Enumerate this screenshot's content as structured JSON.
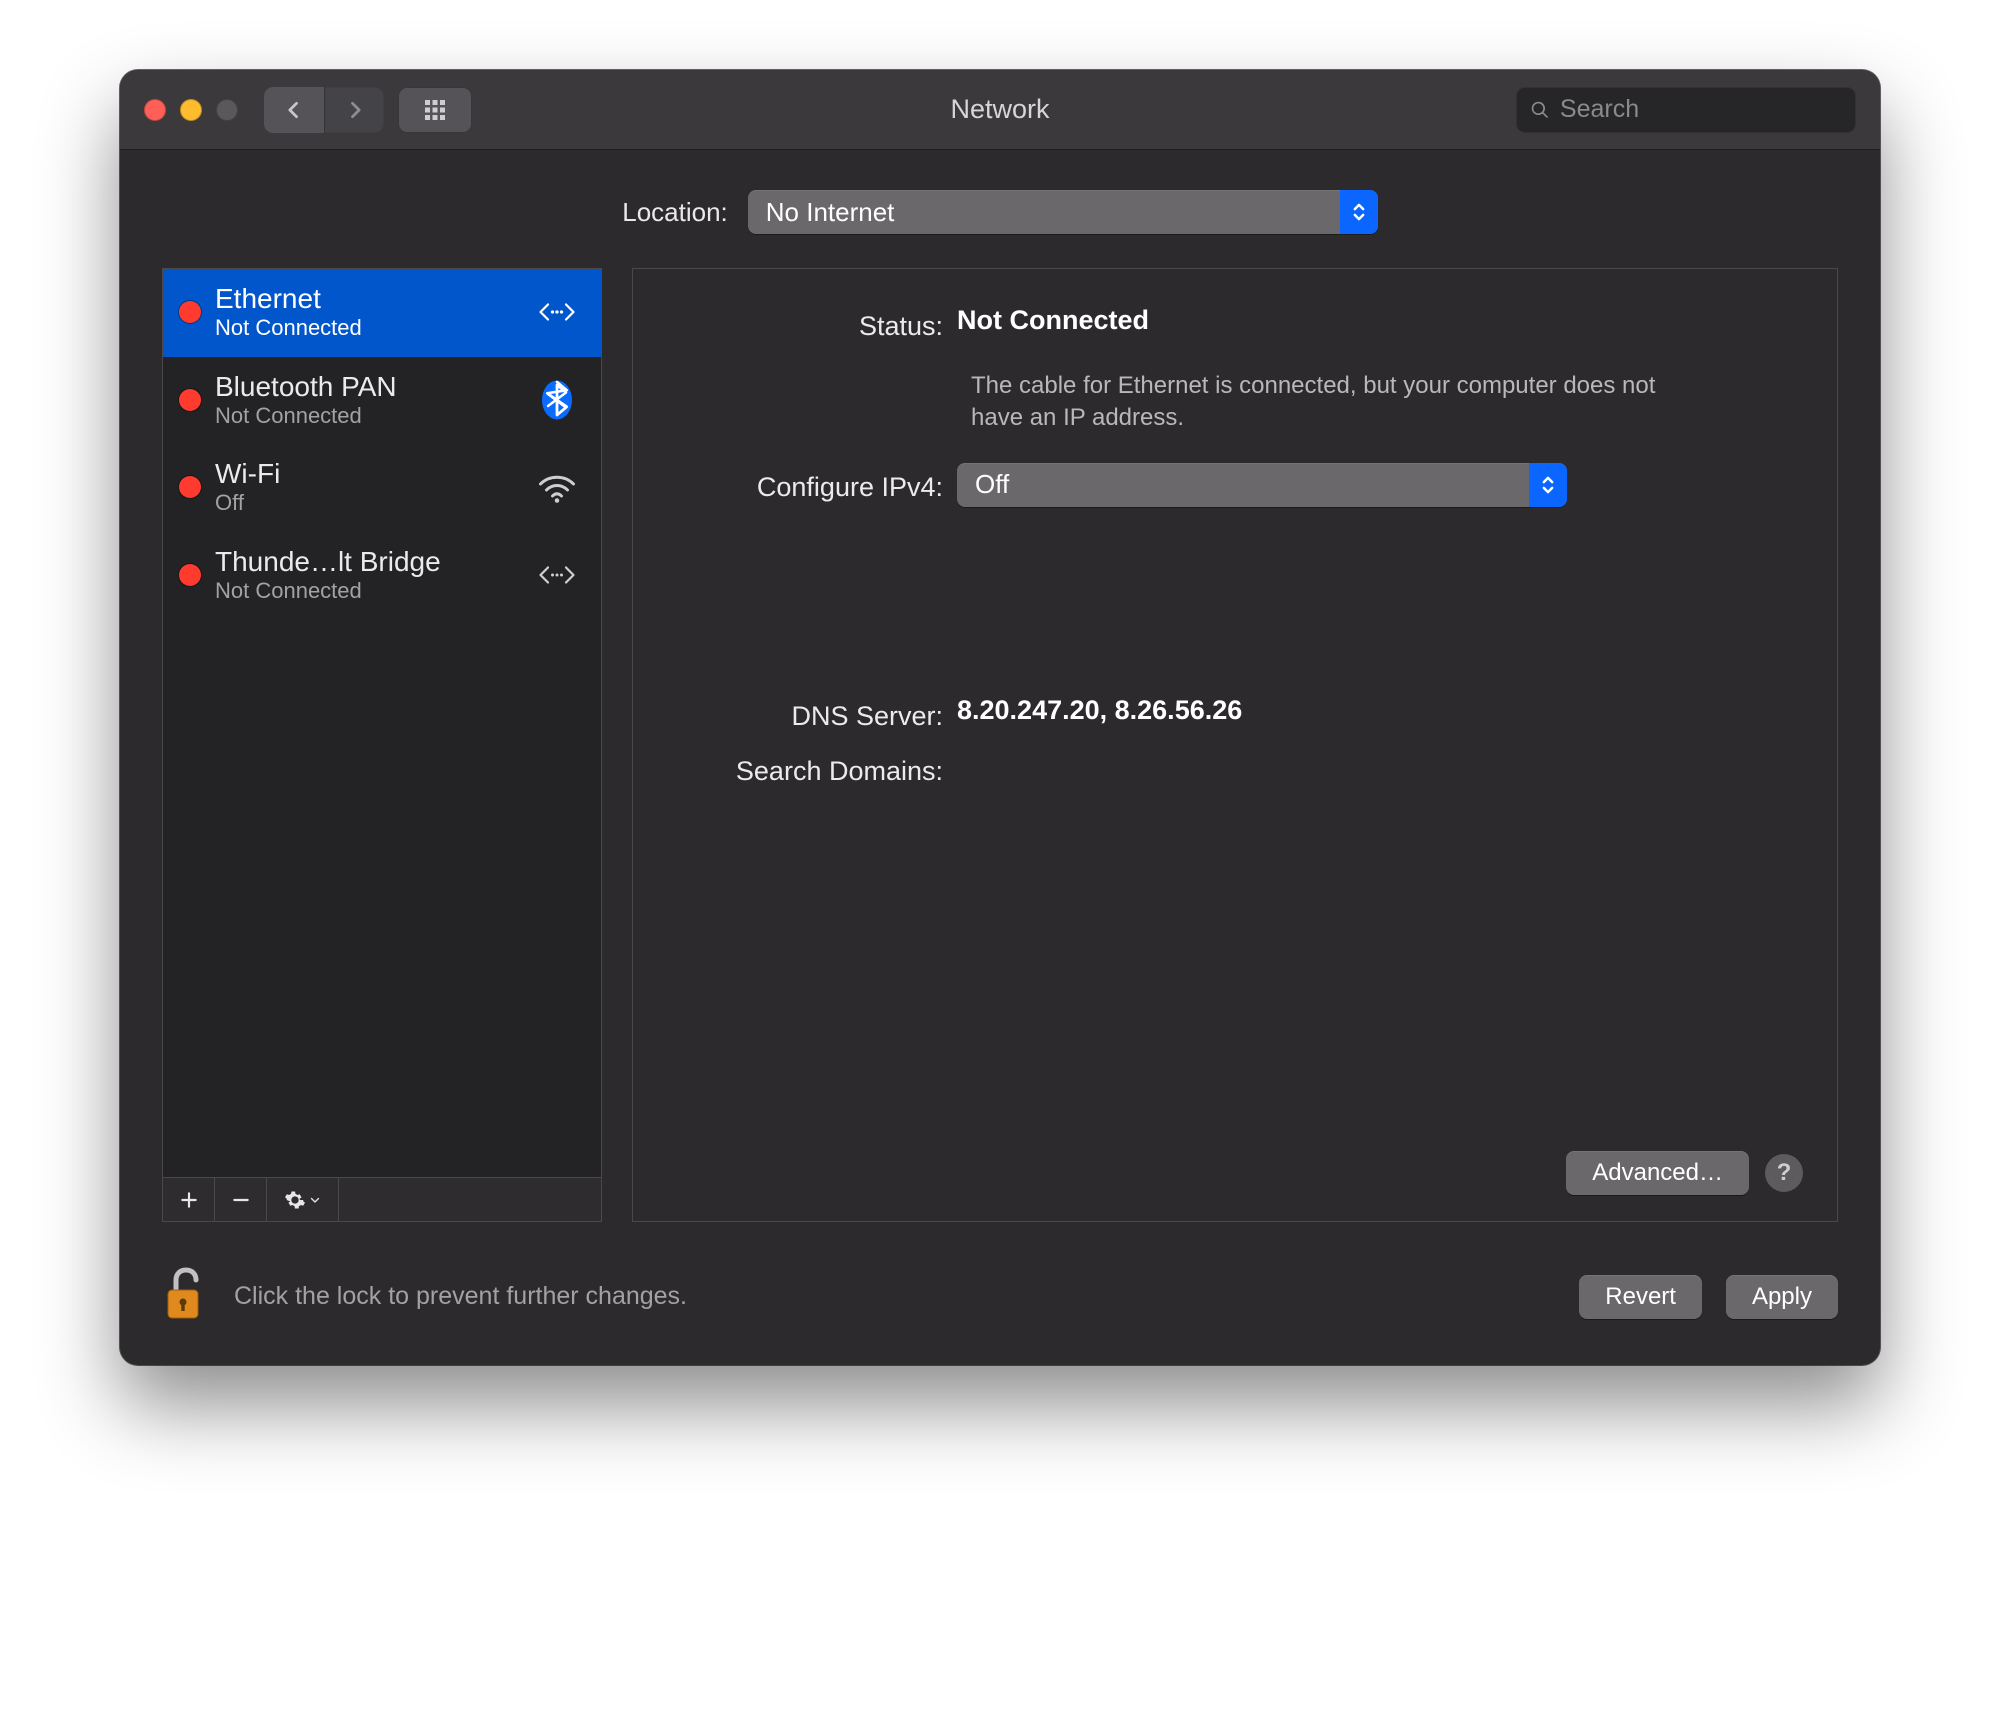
{
  "window": {
    "title": "Network"
  },
  "search": {
    "placeholder": "Search"
  },
  "location": {
    "label": "Location:",
    "value": "No Internet"
  },
  "services": [
    {
      "name": "Ethernet",
      "status": "Not Connected",
      "statusColor": "#ff3b30",
      "icon": "ethernet",
      "selected": true
    },
    {
      "name": "Bluetooth PAN",
      "status": "Not Connected",
      "statusColor": "#ff3b30",
      "icon": "bluetooth",
      "selected": false
    },
    {
      "name": "Wi-Fi",
      "status": "Off",
      "statusColor": "#ff3b30",
      "icon": "wifi",
      "selected": false
    },
    {
      "name": "Thunde…lt Bridge",
      "status": "Not Connected",
      "statusColor": "#ff3b30",
      "icon": "thunderbolt",
      "selected": false
    }
  ],
  "detail": {
    "statusLabel": "Status:",
    "statusValue": "Not Connected",
    "statusHelp": "The cable for Ethernet is connected, but your computer does not have an IP address.",
    "configureLabel": "Configure IPv4:",
    "configureValue": "Off",
    "dnsLabel": "DNS Server:",
    "dnsValue": "8.20.247.20, 8.26.56.26",
    "searchDomainsLabel": "Search Domains:",
    "searchDomainsValue": "",
    "advanced": "Advanced…"
  },
  "footer": {
    "lockText": "Click the lock to prevent further changes.",
    "revert": "Revert",
    "apply": "Apply"
  }
}
